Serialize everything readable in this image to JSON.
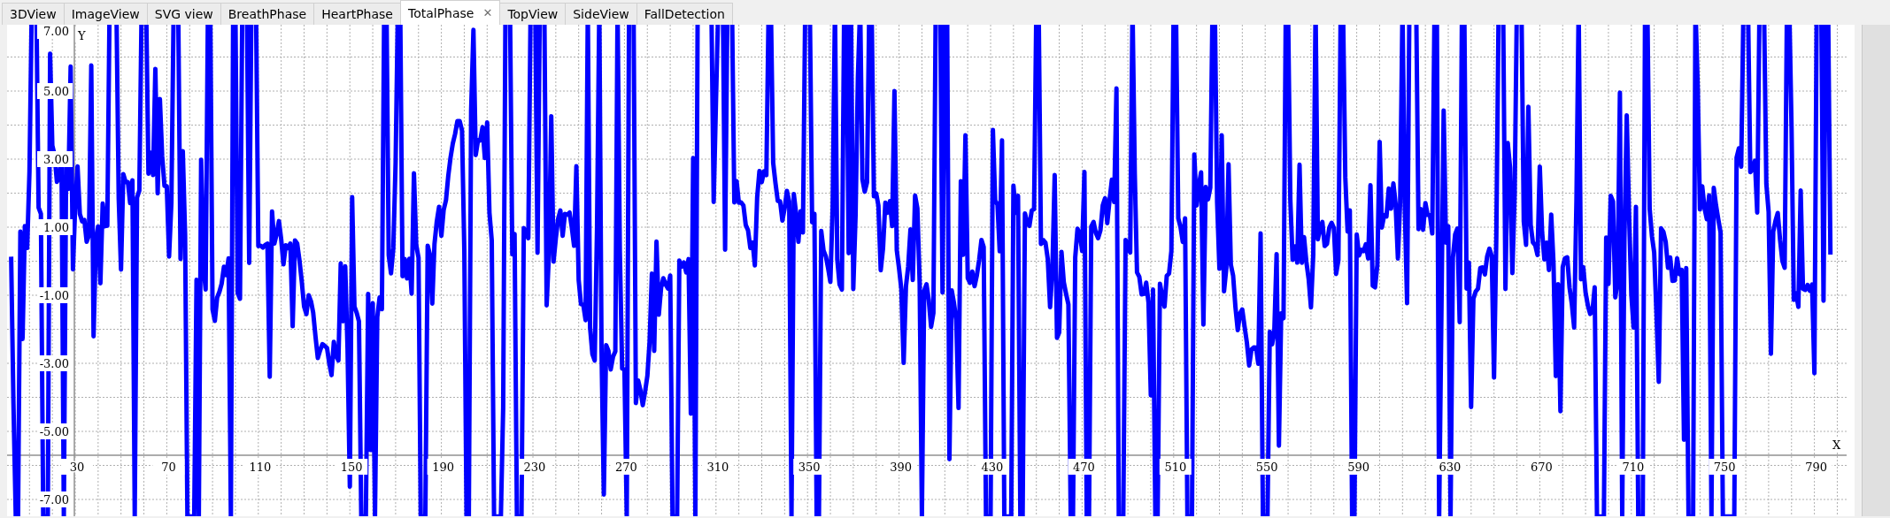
{
  "tabs": [
    {
      "label": "3DView",
      "selected": false
    },
    {
      "label": "ImageView",
      "selected": false
    },
    {
      "label": "SVG view",
      "selected": false
    },
    {
      "label": "BreathPhase",
      "selected": false
    },
    {
      "label": "HeartPhase",
      "selected": false
    },
    {
      "label": "TotalPhase",
      "selected": true,
      "close": "✕"
    },
    {
      "label": "TopView",
      "selected": false
    },
    {
      "label": "SideView",
      "selected": false
    },
    {
      "label": "FallDetection",
      "selected": false
    }
  ],
  "plot": {
    "y_axis_label": "Y",
    "x_axis_label": "X",
    "y_ticks": [
      "7.00",
      "5.00",
      "3.00",
      "1.00",
      "-1.00",
      "-3.00",
      "-5.00",
      "-7.00"
    ],
    "x_ticks": [
      "30",
      "70",
      "110",
      "150",
      "190",
      "230",
      "270",
      "310",
      "350",
      "390",
      "430",
      "470",
      "510",
      "550",
      "590",
      "630",
      "670",
      "710",
      "750",
      "790"
    ]
  }
}
